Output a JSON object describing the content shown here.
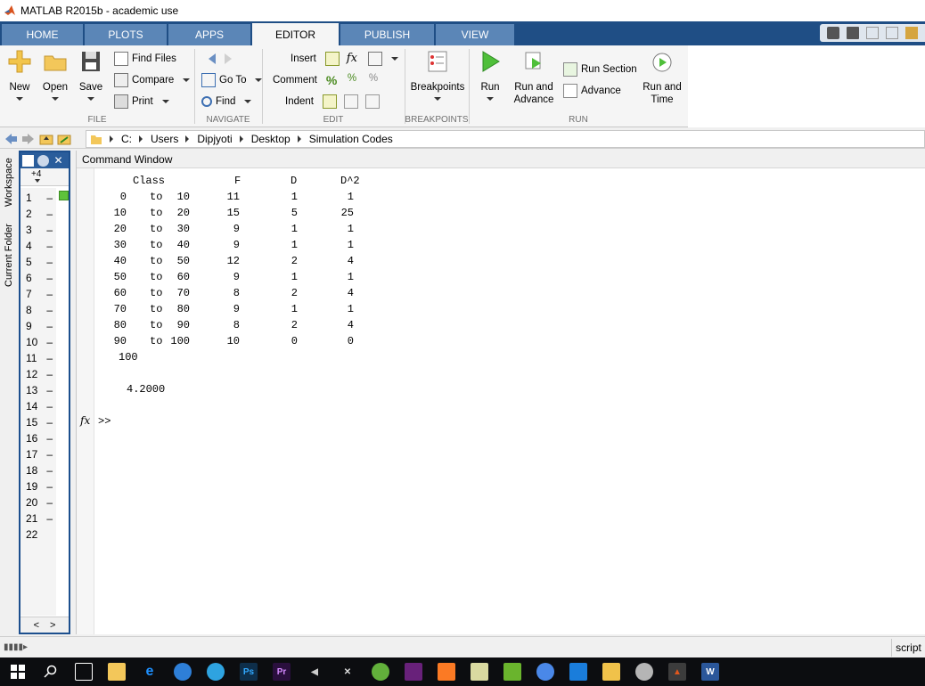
{
  "window": {
    "title": "MATLAB R2015b - academic use"
  },
  "ribbon_tabs": [
    "HOME",
    "PLOTS",
    "APPS",
    "EDITOR",
    "PUBLISH",
    "VIEW"
  ],
  "active_tab": "EDITOR",
  "file_section": {
    "label": "FILE",
    "new": "New",
    "open": "Open",
    "save": "Save",
    "find_files": "Find Files",
    "compare": "Compare",
    "print": "Print"
  },
  "navigate_section": {
    "label": "NAVIGATE",
    "go_to": "Go To",
    "find": "Find"
  },
  "edit_section": {
    "label": "EDIT",
    "insert": "Insert",
    "comment": "Comment",
    "indent": "Indent"
  },
  "breakpoints_section": {
    "label": "BREAKPOINTS",
    "breakpoints": "Breakpoints"
  },
  "run_section": {
    "label": "RUN",
    "run": "Run",
    "run_and_advance_1": "Run and",
    "run_and_advance_2": "Advance",
    "run_section": "Run Section",
    "advance": "Advance",
    "run_and_time_1": "Run and",
    "run_and_time_2": "Time"
  },
  "address": {
    "crumbs": [
      "C:",
      "Users",
      "Dipjyoti",
      "Desktop",
      "Simulation Codes"
    ]
  },
  "side_tabs": {
    "workspace": "Workspace",
    "current_folder": "Current Folder"
  },
  "editor": {
    "tab_count": "+4",
    "line_numbers": [
      "1",
      "2",
      "3",
      "4",
      "5",
      "6",
      "7",
      "8",
      "9",
      "10",
      "11",
      "12",
      "13",
      "14",
      "15",
      "16",
      "17",
      "18",
      "19",
      "20",
      "21",
      "22"
    ]
  },
  "command_window": {
    "title": "Command Window",
    "header": {
      "class": "Class",
      "f": "F",
      "d": "D",
      "d2": "D^2"
    },
    "rows": [
      {
        "from": "0",
        "to": "10",
        "f": "11",
        "d": "1",
        "d2": "1"
      },
      {
        "from": "10",
        "to": "20",
        "f": "15",
        "d": "5",
        "d2": "25"
      },
      {
        "from": "20",
        "to": "30",
        "f": "9",
        "d": "1",
        "d2": "1"
      },
      {
        "from": "30",
        "to": "40",
        "f": "9",
        "d": "1",
        "d2": "1"
      },
      {
        "from": "40",
        "to": "50",
        "f": "12",
        "d": "2",
        "d2": "4"
      },
      {
        "from": "50",
        "to": "60",
        "f": "9",
        "d": "1",
        "d2": "1"
      },
      {
        "from": "60",
        "to": "70",
        "f": "8",
        "d": "2",
        "d2": "4"
      },
      {
        "from": "70",
        "to": "80",
        "f": "9",
        "d": "1",
        "d2": "1"
      },
      {
        "from": "80",
        "to": "90",
        "f": "8",
        "d": "2",
        "d2": "4"
      },
      {
        "from": "90",
        "to": "100",
        "f": "10",
        "d": "0",
        "d2": "0"
      }
    ],
    "word_to": "to",
    "total": "100",
    "result": "4.2000",
    "prompt_fx": "fx",
    "prompt": ">>"
  },
  "status": {
    "mode": "script"
  }
}
